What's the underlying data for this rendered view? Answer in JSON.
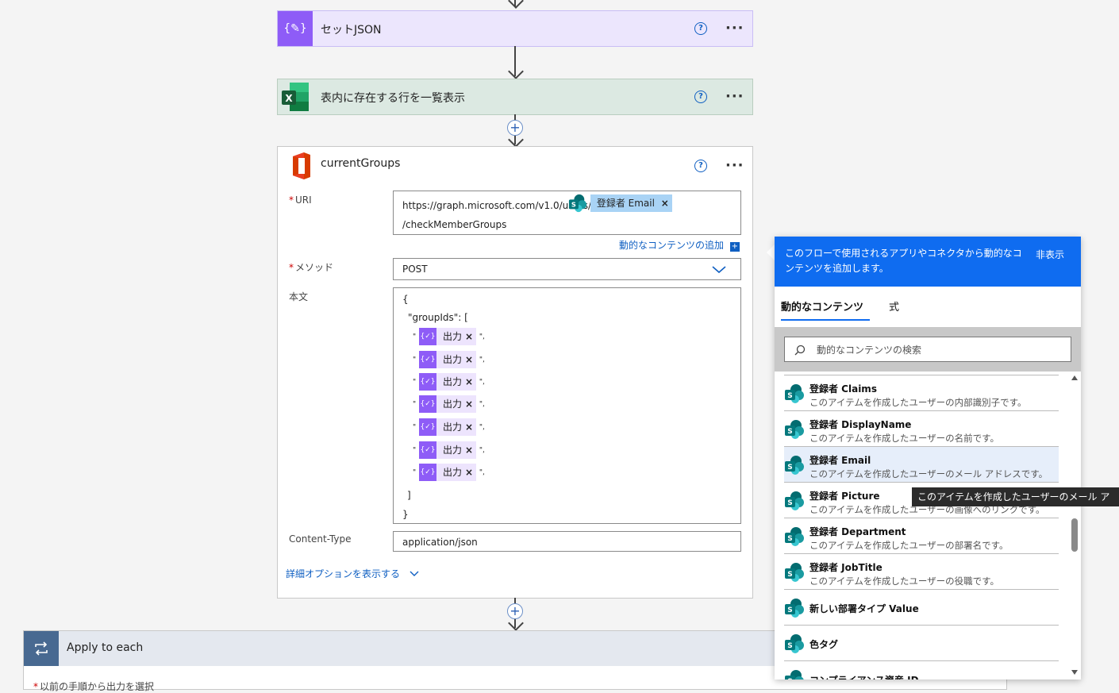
{
  "steps": {
    "set_json": {
      "title": "セットJSON"
    },
    "list_rows": {
      "title": "表内に存在する行を一覧表示"
    },
    "current_groups": {
      "title": "currentGroups",
      "uri": {
        "label": "URI",
        "prefix": "https://graph.microsoft.com/v1.0/users/",
        "token": "登録者 Email",
        "suffix": "/checkMemberGroups"
      },
      "add_dynamic": "動的なコンテンツの追加",
      "method": {
        "label": "メソッド",
        "value": "POST"
      },
      "body": {
        "label": "本文",
        "open_brace": "{",
        "group_ids_line": "\"groupIds\": [",
        "token_label": "出力",
        "tokens": [
          "出力",
          "出力",
          "出力",
          "出力",
          "出力",
          "出力",
          "出力"
        ],
        "close_bracket": "]",
        "close_brace": "}"
      },
      "content_type": {
        "label": "Content-Type",
        "value": "application/json"
      },
      "advanced": "詳細オプションを表示する"
    },
    "apply_each": {
      "title": "Apply to each",
      "select_label": "以前の手順から出力を選択"
    }
  },
  "dynamic_panel": {
    "header_text": "このフローで使用されるアプリやコネクタから動的なコンテンツを追加します。",
    "hide": "非表示",
    "tabs": [
      "動的なコンテンツ",
      "式"
    ],
    "search_placeholder": "動的なコンテンツの検索",
    "items": [
      {
        "title": "登録者 Claims",
        "desc": "このアイテムを作成したユーザーの内部識別子です。"
      },
      {
        "title": "登録者 DisplayName",
        "desc": "このアイテムを作成したユーザーの名前です。"
      },
      {
        "title": "登録者 Email",
        "desc": "このアイテムを作成したユーザーのメール アドレスです。"
      },
      {
        "title": "登録者 Picture",
        "desc": "このアイテムを作成したユーザーの画像へのリンクです。"
      },
      {
        "title": "登録者 Department",
        "desc": "このアイテムを作成したユーザーの部署名です。"
      },
      {
        "title": "登録者 JobTitle",
        "desc": "このアイテムを作成したユーザーの役職です。"
      },
      {
        "title": "新しい部署タイプ Value",
        "desc": ""
      },
      {
        "title": "色タグ",
        "desc": ""
      },
      {
        "title": "コンプライアンス資産 ID",
        "desc": ""
      }
    ],
    "tooltip": "このアイテムを作成したユーザーのメール ア"
  },
  "colors": {
    "accent": "#0f6cf0",
    "variable": "#8e5cf7",
    "excel": "#1d6f42",
    "loop": "#486991"
  }
}
